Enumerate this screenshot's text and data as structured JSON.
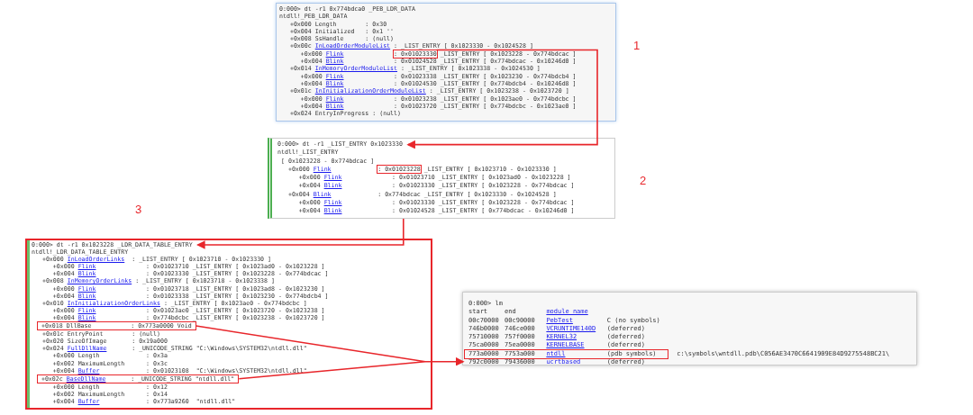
{
  "panels": [
    {
      "kind": "debugger",
      "lines": [
        {
          "kind": "command",
          "text": "0:000> dt -r1 0x774bdca0 _PEB_LDR_DATA"
        },
        {
          "kind": "type",
          "text": "ntdll!_PEB_LDR_DATA"
        },
        {
          "kind": "field",
          "offset": "+0x000",
          "name": "Length",
          "link": false,
          "value": ": 0x30"
        },
        {
          "kind": "field",
          "offset": "+0x004",
          "name": "Initialized",
          "link": false,
          "value": ": 0x1 ''"
        },
        {
          "kind": "field",
          "offset": "+0x008",
          "name": "SsHandle",
          "link": false,
          "value": ": (null)"
        },
        {
          "kind": "field",
          "offset": "+0x00c",
          "name": "InLoadOrderModuleList",
          "link": true,
          "value": ": _LIST_ENTRY [ 0x1023330 - 0x1024528 ]",
          "children": [
            {
              "kind": "field",
              "offset": "+0x000",
              "name": "Flink",
              "link": true,
              "addr": ": 0x01023330",
              "value": "_LIST_ENTRY [ 0x1023228 - 0x774bdcac ]",
              "boxed": true
            },
            {
              "kind": "field",
              "offset": "+0x004",
              "name": "Blink",
              "link": true,
              "value": ": 0x01024528 _LIST_ENTRY [ 0x774bdcac - 0x10246d0 ]"
            }
          ]
        },
        {
          "kind": "field",
          "offset": "+0x014",
          "name": "InMemoryOrderModuleList",
          "link": true,
          "value": ": _LIST_ENTRY [ 0x1023338 - 0x1024530 ]",
          "children": [
            {
              "kind": "field",
              "offset": "+0x000",
              "name": "Flink",
              "link": true,
              "value": ": 0x01023338 _LIST_ENTRY [ 0x1023230 - 0x774bdcb4 ]"
            },
            {
              "kind": "field",
              "offset": "+0x004",
              "name": "Blink",
              "link": true,
              "value": ": 0x01024530 _LIST_ENTRY [ 0x774bdcb4 - 0x10246d8 ]"
            }
          ]
        },
        {
          "kind": "field",
          "offset": "+0x01c",
          "name": "InInitializationOrderModuleList",
          "link": true,
          "value": ": _LIST_ENTRY [ 0x1023238 - 0x1023720 ]",
          "children": [
            {
              "kind": "field",
              "offset": "+0x000",
              "name": "Flink",
              "link": true,
              "value": ": 0x01023238 _LIST_ENTRY [ 0x1023ae0 - 0x774bdcbc ]"
            },
            {
              "kind": "field",
              "offset": "+0x004",
              "name": "Blink",
              "link": true,
              "value": ": 0x01023720 _LIST_ENTRY [ 0x774bdcbc - 0x1023ae0 ]"
            }
          ]
        },
        {
          "kind": "field",
          "offset": "+0x024",
          "name": "EntryInProgress",
          "link": false,
          "value": ": (null)"
        }
      ]
    },
    {
      "kind": "debugger",
      "lines": [
        {
          "kind": "command",
          "text": "0:000> dt -r1 _LIST_ENTRY 0x1023330"
        },
        {
          "kind": "type",
          "text": "ntdll!_LIST_ENTRY"
        },
        {
          "kind": "summary",
          "text": "[ 0x1023228 - 0x774bdcac ]"
        },
        {
          "kind": "field",
          "offset": "+0x000",
          "name": "Flink",
          "link": true,
          "addr": ": 0x01023228",
          "value": "_LIST_ENTRY [ 0x1023710 - 0x1023330 ]",
          "boxed": true,
          "children": [
            {
              "kind": "field",
              "offset": "+0x000",
              "name": "Flink",
              "link": true,
              "value": ": 0x01023710 _LIST_ENTRY [ 0x1023ad0 - 0x1023228 ]"
            },
            {
              "kind": "field",
              "offset": "+0x004",
              "name": "Blink",
              "link": true,
              "value": ": 0x01023330 _LIST_ENTRY [ 0x1023228 - 0x774bdcac ]"
            }
          ]
        },
        {
          "kind": "field",
          "offset": "+0x004",
          "name": "Blink",
          "link": true,
          "value": ": 0x774bdcac _LIST_ENTRY [ 0x1023330 - 0x1024528 ]",
          "children": [
            {
              "kind": "field",
              "offset": "+0x000",
              "name": "Flink",
              "link": true,
              "value": ": 0x01023330 _LIST_ENTRY [ 0x1023228 - 0x774bdcac ]"
            },
            {
              "kind": "field",
              "offset": "+0x004",
              "name": "Blink",
              "link": true,
              "value": ": 0x01024528 _LIST_ENTRY [ 0x774bdcac - 0x10246d0 ]"
            }
          ]
        }
      ]
    },
    {
      "kind": "debugger",
      "lines": [
        {
          "kind": "command",
          "text": "0:000> dt -r1 0x1023228 _LDR_DATA_TABLE_ENTRY"
        },
        {
          "kind": "type",
          "text": "ntdll!_LDR_DATA_TABLE_ENTRY"
        },
        {
          "kind": "field",
          "offset": "+0x000",
          "name": "InLoadOrderLinks",
          "link": true,
          "value": ": _LIST_ENTRY [ 0x1023710 - 0x1023330 ]",
          "children": [
            {
              "kind": "field",
              "offset": "+0x000",
              "name": "Flink",
              "link": true,
              "value": ": 0x01023710 _LIST_ENTRY [ 0x1023ad0 - 0x1023228 ]"
            },
            {
              "kind": "field",
              "offset": "+0x004",
              "name": "Blink",
              "link": true,
              "value": ": 0x01023330 _LIST_ENTRY [ 0x1023228 - 0x774bdcac ]"
            }
          ]
        },
        {
          "kind": "field",
          "offset": "+0x008",
          "name": "InMemoryOrderLinks",
          "link": true,
          "value": ": _LIST_ENTRY [ 0x1023718 - 0x1023338 ]",
          "children": [
            {
              "kind": "field",
              "offset": "+0x000",
              "name": "Flink",
              "link": true,
              "value": ": 0x01023718 _LIST_ENTRY [ 0x1023ad8 - 0x1023230 ]"
            },
            {
              "kind": "field",
              "offset": "+0x004",
              "name": "Blink",
              "link": true,
              "value": ": 0x01023338 _LIST_ENTRY [ 0x1023230 - 0x774bdcb4 ]"
            }
          ]
        },
        {
          "kind": "field",
          "offset": "+0x010",
          "name": "InInitializationOrderLinks",
          "link": true,
          "value": ": _LIST_ENTRY [ 0x1023ae0 - 0x774bdcbc ]",
          "children": [
            {
              "kind": "field",
              "offset": "+0x000",
              "name": "Flink",
              "link": true,
              "value": ": 0x01023ae0 _LIST_ENTRY [ 0x1023720 - 0x1023238 ]"
            },
            {
              "kind": "field",
              "offset": "+0x004",
              "name": "Blink",
              "link": true,
              "value": ": 0x774bdcbc _LIST_ENTRY [ 0x1023238 - 0x1023720 ]"
            }
          ]
        },
        {
          "kind": "field",
          "offset": "+0x018",
          "name": "DllBase",
          "link": false,
          "value": ": 0x773a0000 Void",
          "boxed": true
        },
        {
          "kind": "field",
          "offset": "+0x01c",
          "name": "EntryPoint",
          "link": false,
          "value": ": (null)"
        },
        {
          "kind": "field",
          "offset": "+0x020",
          "name": "SizeOfImage",
          "link": false,
          "value": ": 0x19a000"
        },
        {
          "kind": "field",
          "offset": "+0x024",
          "name": "FullDllName",
          "link": true,
          "value": ": _UNICODE_STRING \"C:\\Windows\\SYSTEM32\\ntdll.dll\"",
          "children": [
            {
              "kind": "field",
              "offset": "+0x000",
              "name": "Length",
              "link": false,
              "value": ": 0x3a"
            },
            {
              "kind": "field",
              "offset": "+0x002",
              "name": "MaximumLength",
              "link": false,
              "value": ": 0x3c"
            },
            {
              "kind": "field",
              "offset": "+0x004",
              "name": "Buffer",
              "link": true,
              "value": ": 0x01023108  \"C:\\Windows\\SYSTEM32\\ntdll.dll\""
            }
          ]
        },
        {
          "kind": "field",
          "offset": "+0x02c",
          "name": "BaseDllName",
          "link": true,
          "value": ": _UNICODE_STRING \"ntdll.dll\"",
          "boxed": true,
          "children": [
            {
              "kind": "field",
              "offset": "+0x000",
              "name": "Length",
              "link": false,
              "value": ": 0x12"
            },
            {
              "kind": "field",
              "offset": "+0x002",
              "name": "MaximumLength",
              "link": false,
              "value": ": 0x14"
            },
            {
              "kind": "field",
              "offset": "+0x004",
              "name": "Buffer",
              "link": true,
              "value": ": 0x773a9260  \"ntdll.dll\""
            }
          ]
        }
      ]
    },
    {
      "kind": "module_list",
      "command": "0:000> lm",
      "columns": [
        "start",
        "end",
        "module name"
      ],
      "rows": [
        {
          "start": "00c70000",
          "end": "00c90000",
          "module": "PebTest",
          "info": "C (no symbols)",
          "boxed": false
        },
        {
          "start": "746b0000",
          "end": "746ce000",
          "module": "VCRUNTIME140D",
          "info": "(deferred)",
          "boxed": false
        },
        {
          "start": "75710000",
          "end": "757f0000",
          "module": "KERNEL32",
          "info": "(deferred)",
          "boxed": false
        },
        {
          "start": "75ca0000",
          "end": "75ea0000",
          "module": "KERNELBASE",
          "info": "(deferred)",
          "boxed": false
        },
        {
          "start": "773a0000",
          "end": "7753a000",
          "module": "ntdll",
          "info": "(pdb symbols)",
          "path": "c:\\symbols\\wntdll.pdb\\C056AE3470C6641909E84D9275548BC21\\",
          "boxed": true
        },
        {
          "start": "792c0000",
          "end": "79436000",
          "module": "ucrtbased",
          "info": "(deferred)",
          "boxed": false
        }
      ]
    }
  ],
  "step_labels": [
    "1",
    "2",
    "3"
  ]
}
